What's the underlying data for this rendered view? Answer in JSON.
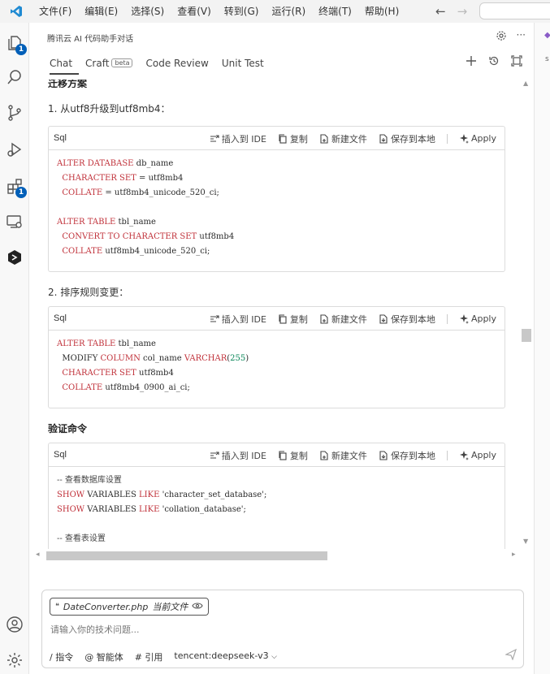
{
  "menu": [
    "文件(F)",
    "编辑(E)",
    "选择(S)",
    "查看(V)",
    "转到(G)",
    "运行(R)",
    "终端(T)",
    "帮助(H)"
  ],
  "activity": {
    "explorer_badge": "1",
    "extensions_badge": "1"
  },
  "panel": {
    "title": "腾讯云 AI 代码助手对话",
    "tabs": [
      {
        "label": "Chat",
        "active": true
      },
      {
        "label": "Craft",
        "badge": "beta"
      },
      {
        "label": "Code Review"
      },
      {
        "label": "Unit Test"
      }
    ]
  },
  "content": {
    "cut_heading": "迁移方案",
    "step1": "1. 从utf8升级到utf8mb4：",
    "step2": "2. 排序规则变更：",
    "verify_heading": "验证命令"
  },
  "code_actions": {
    "insert": "插入到 IDE",
    "copy": "复制",
    "new_file": "新建文件",
    "save_local": "保存到本地",
    "apply": "Apply"
  },
  "code_blocks": [
    {
      "lang": "Sql",
      "lines": [
        [
          [
            "kw",
            "ALTER DATABASE"
          ],
          [
            "t",
            " db_name"
          ]
        ],
        [
          [
            "t",
            "  "
          ],
          [
            "kw",
            "CHARACTER SET"
          ],
          [
            "t",
            " = utf8mb4"
          ]
        ],
        [
          [
            "t",
            "  "
          ],
          [
            "kw",
            "COLLATE"
          ],
          [
            "t",
            " = utf8mb4_unicode_520_ci;"
          ]
        ],
        [
          [
            "t",
            ""
          ]
        ],
        [
          [
            "kw",
            "ALTER TABLE"
          ],
          [
            "t",
            " tbl_name"
          ]
        ],
        [
          [
            "t",
            "  "
          ],
          [
            "kw",
            "CONVERT TO CHARACTER SET"
          ],
          [
            "t",
            " utf8mb4"
          ]
        ],
        [
          [
            "t",
            "  "
          ],
          [
            "kw",
            "COLLATE"
          ],
          [
            "t",
            " utf8mb4_unicode_520_ci;"
          ]
        ]
      ]
    },
    {
      "lang": "Sql",
      "lines": [
        [
          [
            "kw",
            "ALTER TABLE"
          ],
          [
            "t",
            " tbl_name"
          ]
        ],
        [
          [
            "t",
            "  MODIFY "
          ],
          [
            "kw",
            "COLUMN"
          ],
          [
            "t",
            " col_name "
          ],
          [
            "kw",
            "VARCHAR"
          ],
          [
            "t",
            "("
          ],
          [
            "num",
            "255"
          ],
          [
            "t",
            ")"
          ]
        ],
        [
          [
            "t",
            "  "
          ],
          [
            "kw",
            "CHARACTER SET"
          ],
          [
            "t",
            " utf8mb4"
          ]
        ],
        [
          [
            "t",
            "  "
          ],
          [
            "kw",
            "COLLATE"
          ],
          [
            "t",
            " utf8mb4_0900_ai_ci;"
          ]
        ]
      ]
    },
    {
      "lang": "Sql",
      "lines": [
        [
          [
            "cm",
            "-- 查看数据库设置"
          ]
        ],
        [
          [
            "kw",
            "SHOW"
          ],
          [
            "t",
            " VARIABLES "
          ],
          [
            "kw",
            "LIKE"
          ],
          [
            "t",
            " 'character_set_database';"
          ]
        ],
        [
          [
            "kw",
            "SHOW"
          ],
          [
            "t",
            " VARIABLES "
          ],
          [
            "kw",
            "LIKE"
          ],
          [
            "t",
            " 'collation_database';"
          ]
        ],
        [
          [
            "t",
            ""
          ]
        ],
        [
          [
            "cm",
            "-- 查看表设置"
          ]
        ]
      ]
    }
  ],
  "input": {
    "file_name": "DateConverter.php",
    "file_tag": "当前文件",
    "placeholder": "请输入你的技术问题...",
    "command": "/ 指令",
    "agent": "@ 智能体",
    "reference": "# 引用",
    "model": "tencent:deepseek-v3"
  }
}
